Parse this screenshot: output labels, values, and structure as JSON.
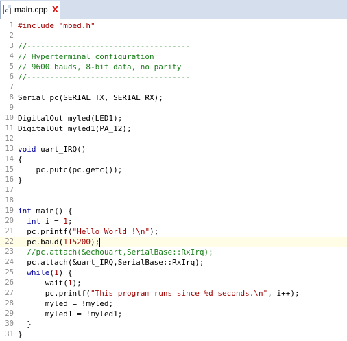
{
  "tab": {
    "filename": "main.cpp",
    "icon": "cpp-file-icon",
    "close_glyph": "X"
  },
  "current_line": 22,
  "lines": [
    {
      "n": "1",
      "parts": [
        {
          "t": "#include \"mbed.h\"",
          "c": "pre"
        }
      ]
    },
    {
      "n": "2",
      "parts": []
    },
    {
      "n": "3",
      "parts": [
        {
          "t": "//------------------------------------",
          "c": "com"
        }
      ]
    },
    {
      "n": "4",
      "parts": [
        {
          "t": "// Hyperterminal configuration",
          "c": "com"
        }
      ]
    },
    {
      "n": "5",
      "parts": [
        {
          "t": "// 9600 bauds, 8-bit data, no parity",
          "c": "com"
        }
      ]
    },
    {
      "n": "6",
      "parts": [
        {
          "t": "//------------------------------------",
          "c": "com"
        }
      ]
    },
    {
      "n": "7",
      "parts": []
    },
    {
      "n": "8",
      "parts": [
        {
          "t": "Serial pc(SERIAL_TX, SERIAL_RX);",
          "c": ""
        }
      ]
    },
    {
      "n": "9",
      "parts": []
    },
    {
      "n": "10",
      "parts": [
        {
          "t": "DigitalOut myled(LED1);",
          "c": ""
        }
      ]
    },
    {
      "n": "11",
      "parts": [
        {
          "t": "DigitalOut myled1(PA_12);",
          "c": ""
        }
      ]
    },
    {
      "n": "12",
      "parts": []
    },
    {
      "n": "13",
      "parts": [
        {
          "t": "void",
          "c": "kw"
        },
        {
          "t": " uart_IRQ()",
          "c": ""
        }
      ]
    },
    {
      "n": "14",
      "parts": [
        {
          "t": "{",
          "c": ""
        }
      ]
    },
    {
      "n": "15",
      "parts": [
        {
          "t": "    pc.putc(pc.getc());",
          "c": ""
        }
      ]
    },
    {
      "n": "16",
      "parts": [
        {
          "t": "}",
          "c": ""
        }
      ]
    },
    {
      "n": "17",
      "parts": []
    },
    {
      "n": "18",
      "parts": []
    },
    {
      "n": "19",
      "parts": [
        {
          "t": "int",
          "c": "kw"
        },
        {
          "t": " main() {",
          "c": ""
        }
      ]
    },
    {
      "n": "20",
      "parts": [
        {
          "t": "  ",
          "c": ""
        },
        {
          "t": "int",
          "c": "kw"
        },
        {
          "t": " i = ",
          "c": ""
        },
        {
          "t": "1",
          "c": "num"
        },
        {
          "t": ";",
          "c": ""
        }
      ]
    },
    {
      "n": "21",
      "parts": [
        {
          "t": "  pc.printf(",
          "c": ""
        },
        {
          "t": "\"Hello World !\\n\"",
          "c": "str"
        },
        {
          "t": ");",
          "c": ""
        }
      ]
    },
    {
      "n": "22",
      "parts": [
        {
          "t": "  pc.baud(",
          "c": ""
        },
        {
          "t": "115200",
          "c": "num"
        },
        {
          "t": ");",
          "c": ""
        }
      ],
      "caret": true
    },
    {
      "n": "23",
      "parts": [
        {
          "t": "  //pc.attach(&echouart,SerialBase::RxIrq);",
          "c": "com"
        }
      ]
    },
    {
      "n": "24",
      "parts": [
        {
          "t": "  pc.attach(&uart_IRQ,SerialBase::RxIrq);",
          "c": ""
        }
      ]
    },
    {
      "n": "25",
      "parts": [
        {
          "t": "  ",
          "c": ""
        },
        {
          "t": "while",
          "c": "kw"
        },
        {
          "t": "(",
          "c": ""
        },
        {
          "t": "1",
          "c": "num"
        },
        {
          "t": ") {",
          "c": ""
        }
      ]
    },
    {
      "n": "26",
      "parts": [
        {
          "t": "      wait(",
          "c": ""
        },
        {
          "t": "1",
          "c": "num"
        },
        {
          "t": ");",
          "c": ""
        }
      ]
    },
    {
      "n": "27",
      "parts": [
        {
          "t": "      pc.printf(",
          "c": ""
        },
        {
          "t": "\"This program runs since %d seconds.\\n\"",
          "c": "str"
        },
        {
          "t": ", i++);",
          "c": ""
        }
      ]
    },
    {
      "n": "28",
      "parts": [
        {
          "t": "      myled = !myled;",
          "c": ""
        }
      ]
    },
    {
      "n": "29",
      "parts": [
        {
          "t": "      myled1 = !myled1;",
          "c": ""
        }
      ]
    },
    {
      "n": "30",
      "parts": [
        {
          "t": "  }",
          "c": ""
        }
      ]
    },
    {
      "n": "31",
      "parts": [
        {
          "t": "}",
          "c": ""
        }
      ]
    }
  ]
}
